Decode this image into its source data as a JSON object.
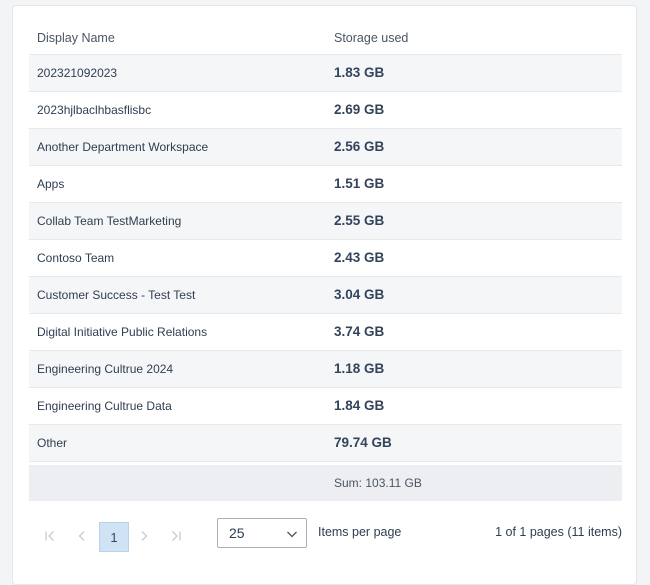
{
  "table": {
    "columns": {
      "name": "Display Name",
      "storage": "Storage used"
    },
    "rows": [
      {
        "name": "202321092023",
        "storage": "1.83 GB"
      },
      {
        "name": "2023hjlbaclhbasflisbc",
        "storage": "2.69 GB"
      },
      {
        "name": "Another Department Workspace",
        "storage": "2.56 GB"
      },
      {
        "name": "Apps",
        "storage": "1.51 GB"
      },
      {
        "name": "Collab Team TestMarketing",
        "storage": "2.55 GB"
      },
      {
        "name": "Contoso Team",
        "storage": "2.43 GB"
      },
      {
        "name": "Customer Success - Test Test",
        "storage": "3.04 GB"
      },
      {
        "name": "Digital Initiative Public Relations",
        "storage": "3.74 GB"
      },
      {
        "name": "Engineering Cultrue 2024",
        "storage": "1.18 GB"
      },
      {
        "name": "Engineering Cultrue Data",
        "storage": "1.84 GB"
      },
      {
        "name": "Other",
        "storage": "79.74 GB"
      }
    ],
    "sum_label": "Sum: 103.11 GB"
  },
  "pager": {
    "current_page": "1",
    "page_size": "25",
    "items_per_page_label": "Items per page",
    "page_info": "1 of 1 pages (11 items)",
    "icons": [
      "first-page-icon",
      "previous-page-icon",
      "next-page-icon",
      "last-page-icon",
      "chevron-down-icon"
    ]
  }
}
